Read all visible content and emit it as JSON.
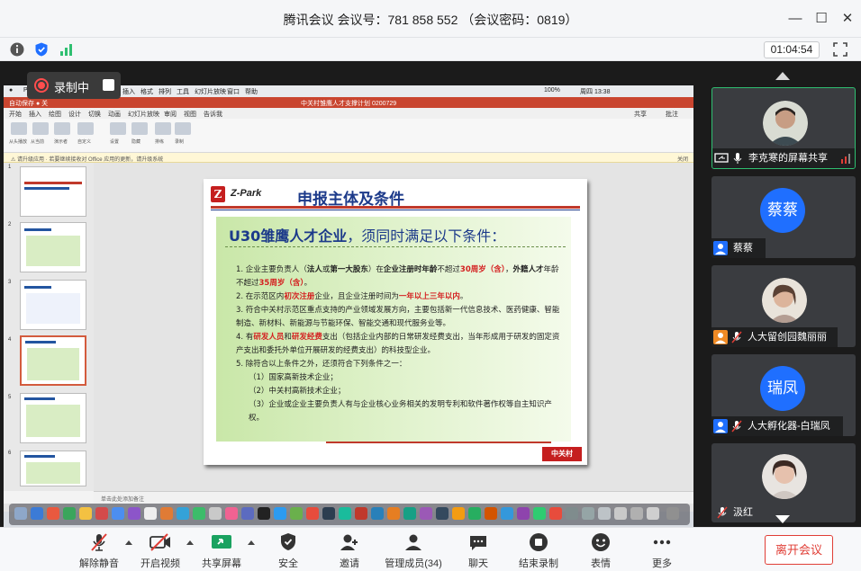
{
  "window": {
    "title": "腾讯会议 会议号：781 858 552 （会议密码：0819）"
  },
  "status": {
    "timer": "01:04:54",
    "icons": [
      "info-icon",
      "shield-icon",
      "signal-icon",
      "fullscreen-icon"
    ]
  },
  "recording": {
    "label": "录制中"
  },
  "slide": {
    "brand": "Z-Park",
    "heading": "申报主体及条件",
    "title_bold": "U30雏鹰人才企业",
    "title_rest": "，须同时满足以下条件：",
    "items": [
      {
        "a": "1.  企业主要负责人（",
        "b": "法人",
        "c": "或",
        "d": "第一大股东",
        "e": "）在",
        "f": "企业注册时年龄",
        "g": "不超过",
        "h": "30周岁（含）",
        "i": "，",
        "j": "外籍人才",
        "k": "年龄不超过",
        "l": "35周岁（含）",
        "m": "。"
      },
      {
        "a": "2.  在示范区内",
        "b": "初次注册",
        "c": "企业，且企业注册时间为",
        "d": "一年以上三年以内",
        "e": "。"
      },
      {
        "a": "3.  符合中关村示范区重点支持的产业领域发展方向，主要包括新一代信息技术、医药健康、智能制造、新材料、新能源与节能环保、智能交通和现代服务业等。"
      },
      {
        "a": "4.  有",
        "b": "研发人员",
        "c": "和",
        "d": "研发经费",
        "e": "支出（包括企业内部的日常研发经费支出，当年形成用于研发的固定资产支出和委托外单位开展研发的经费支出）的科技型企业。"
      },
      {
        "a": "5.  除符合以上条件之外，还须符合下列条件之一："
      },
      {
        "a": "（1）国家高新技术企业；"
      },
      {
        "a": "（2）中关村高新技术企业；"
      },
      {
        "a": "（3）企业或企业主要负责人有与企业核心业务相关的发明专利和软件著作权等自主知识产权。"
      }
    ],
    "stamp": "中关村"
  },
  "ppt": {
    "notes_placeholder": "单击此处添加备注"
  },
  "participants": [
    {
      "name": "李克寒的屏幕共享",
      "type": "photo",
      "color": "#4a4a4a"
    },
    {
      "name": "蔡蔡",
      "avatar_text": "蔡蔡",
      "type": "text"
    },
    {
      "name": "人大留创园魏丽丽",
      "type": "photo",
      "color": "#6d5a4d"
    },
    {
      "name": "人大孵化器-白瑞凤",
      "avatar_text": "瑞凤",
      "type": "text"
    },
    {
      "name": "汲红",
      "type": "photo",
      "color": "#8a6f63"
    }
  ],
  "toolbar": {
    "mute": "解除静音",
    "video": "开启视频",
    "share": "共享屏幕",
    "security": "安全",
    "invite": "邀请",
    "members": "管理成员(34)",
    "chat": "聊天",
    "end_record": "结束录制",
    "reaction": "表情",
    "more": "更多",
    "leave": "离开会议"
  },
  "colors": {
    "accent_blue": "#1f6fff",
    "leave_red": "#e03e36",
    "active_green": "#2fbf71"
  }
}
